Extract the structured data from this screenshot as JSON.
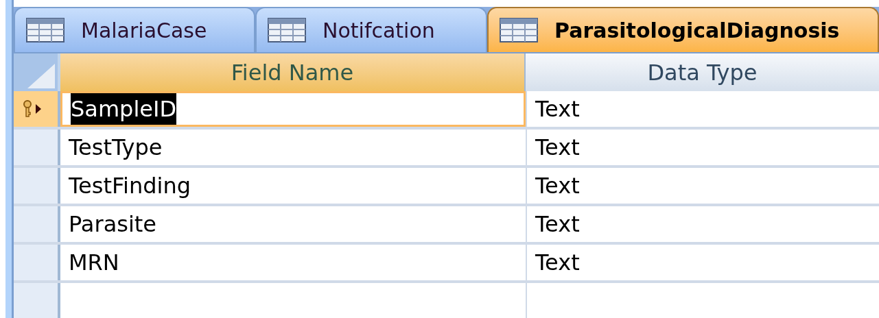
{
  "tabs": [
    {
      "label": "MalariaCase",
      "selected": false
    },
    {
      "label": "Notifcation",
      "selected": false
    },
    {
      "label": "ParasitologicalDiagnosis",
      "selected": true
    }
  ],
  "table": {
    "columns": [
      "Field Name",
      "Data Type"
    ],
    "rows": [
      {
        "field_name": "SampleID",
        "data_type": "Text",
        "primary_key": true,
        "selected": true
      },
      {
        "field_name": "TestType",
        "data_type": "Text",
        "primary_key": false,
        "selected": false
      },
      {
        "field_name": "TestFinding",
        "data_type": "Text",
        "primary_key": false,
        "selected": false
      },
      {
        "field_name": "Parasite",
        "data_type": "Text",
        "primary_key": false,
        "selected": false
      },
      {
        "field_name": "MRN",
        "data_type": "Text",
        "primary_key": false,
        "selected": false
      }
    ]
  }
}
